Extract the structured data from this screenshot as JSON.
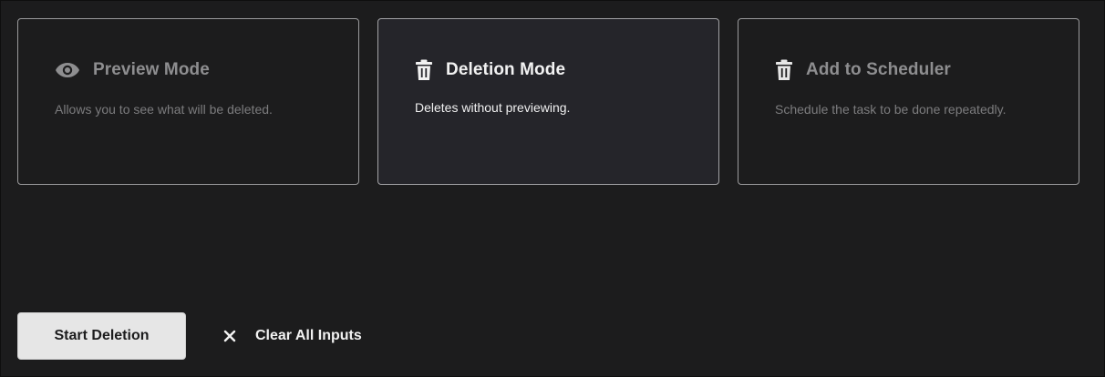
{
  "modes": [
    {
      "title": "Preview Mode",
      "description": "Allows you to see what will be deleted.",
      "icon": "eye-icon",
      "selected": false
    },
    {
      "title": "Deletion Mode",
      "description": "Deletes without previewing.",
      "icon": "trash-icon",
      "selected": true
    },
    {
      "title": "Add to Scheduler",
      "description": "Schedule the task to be done repeatedly.",
      "icon": "trash-icon",
      "selected": false
    }
  ],
  "actions": {
    "start_label": "Start Deletion",
    "clear_label": "Clear All Inputs",
    "clear_icon": "close-icon"
  },
  "colors": {
    "background": "#1c1c1d",
    "selected_card": "#25252a",
    "muted_text": "#8e8e90",
    "primary_text": "#f2f2f2",
    "button_bg": "#e6e6e6"
  }
}
